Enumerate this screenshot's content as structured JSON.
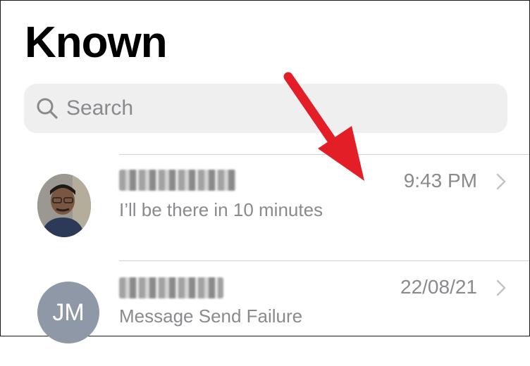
{
  "header": {
    "title": "Known"
  },
  "search": {
    "placeholder": "Search"
  },
  "conversations": [
    {
      "time": "9:43 PM",
      "preview": "I’ll be there in 10 minutes",
      "avatar": "photo"
    },
    {
      "time": "22/08/21",
      "preview": "Message Send Failure",
      "avatar": "initials",
      "initials": "JM"
    }
  ],
  "colors": {
    "annotation_arrow": "#e41e26",
    "secondary_text": "#8a8a8e",
    "search_bg": "#efeff0"
  }
}
